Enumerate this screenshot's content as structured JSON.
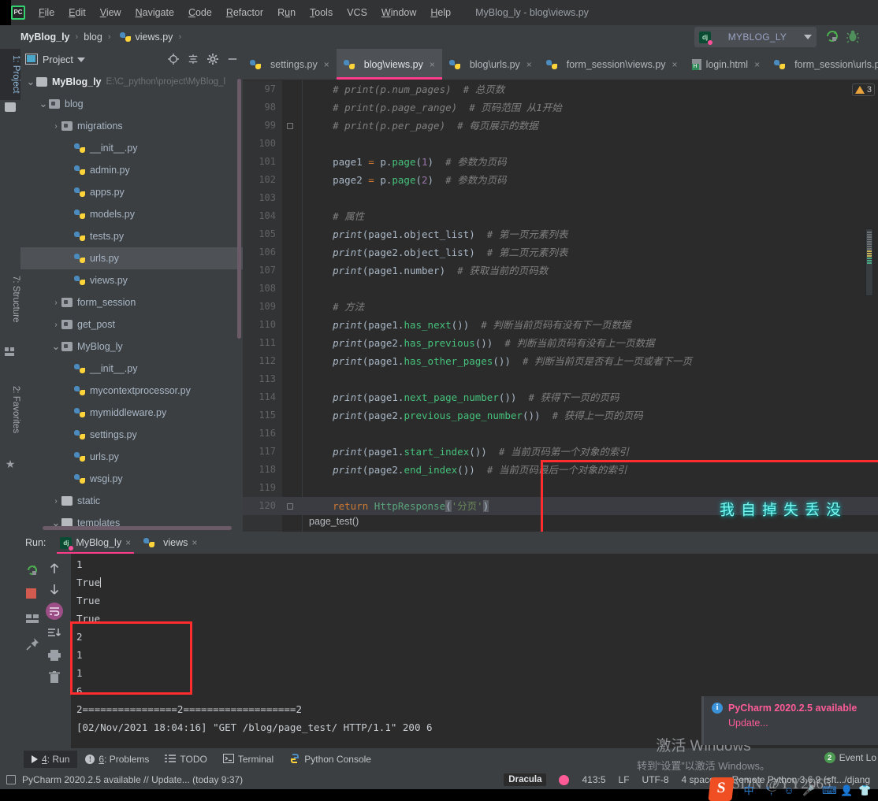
{
  "app": {
    "logo": "PC",
    "window_title": "MyBlog_ly - blog\\views.py"
  },
  "menu": {
    "items": [
      "File",
      "Edit",
      "View",
      "Navigate",
      "Code",
      "Refactor",
      "Run",
      "Tools",
      "VCS",
      "Window",
      "Help"
    ]
  },
  "breadcrumb": {
    "items": [
      "MyBlog_ly",
      "blog",
      "views.py"
    ],
    "separator": "›"
  },
  "toolbar": {
    "run_config": "MYBLOG_LY",
    "run_icon": "run-icon",
    "debug_icon": "debug-icon",
    "dj_icon": "dj"
  },
  "left_strip": {
    "project_tab": "1: Project",
    "structure_tab": "7: Structure",
    "favorites_tab": "2: Favorites"
  },
  "project_panel": {
    "title": "Project",
    "icons": [
      "locate-icon",
      "collapse-all-icon",
      "gear-icon",
      "minimize-icon"
    ],
    "tree": [
      {
        "indent": 0,
        "arrow": "⌄",
        "icon": "folder",
        "name": "MyBlog_ly",
        "path": "E:\\C_python\\project\\MyBlog_l",
        "root": true
      },
      {
        "indent": 1,
        "arrow": "⌄",
        "icon": "folder-mod",
        "name": "blog"
      },
      {
        "indent": 2,
        "arrow": "›",
        "icon": "folder-mod",
        "name": "migrations"
      },
      {
        "indent": 3,
        "arrow": "",
        "icon": "py",
        "name": "__init__.py"
      },
      {
        "indent": 3,
        "arrow": "",
        "icon": "py",
        "name": "admin.py"
      },
      {
        "indent": 3,
        "arrow": "",
        "icon": "py",
        "name": "apps.py"
      },
      {
        "indent": 3,
        "arrow": "",
        "icon": "py",
        "name": "models.py"
      },
      {
        "indent": 3,
        "arrow": "",
        "icon": "py",
        "name": "tests.py"
      },
      {
        "indent": 3,
        "arrow": "",
        "icon": "py",
        "name": "urls.py",
        "selected": true
      },
      {
        "indent": 3,
        "arrow": "",
        "icon": "py",
        "name": "views.py"
      },
      {
        "indent": 2,
        "arrow": "›",
        "icon": "folder-mod",
        "name": "form_session"
      },
      {
        "indent": 2,
        "arrow": "›",
        "icon": "folder-mod",
        "name": "get_post"
      },
      {
        "indent": 2,
        "arrow": "⌄",
        "icon": "folder-mod",
        "name": "MyBlog_ly"
      },
      {
        "indent": 3,
        "arrow": "",
        "icon": "py",
        "name": "__init__.py"
      },
      {
        "indent": 3,
        "arrow": "",
        "icon": "py",
        "name": "mycontextprocessor.py"
      },
      {
        "indent": 3,
        "arrow": "",
        "icon": "py",
        "name": "mymiddleware.py"
      },
      {
        "indent": 3,
        "arrow": "",
        "icon": "py",
        "name": "settings.py"
      },
      {
        "indent": 3,
        "arrow": "",
        "icon": "py",
        "name": "urls.py"
      },
      {
        "indent": 3,
        "arrow": "",
        "icon": "py",
        "name": "wsgi.py"
      },
      {
        "indent": 2,
        "arrow": "›",
        "icon": "folder",
        "name": "static"
      },
      {
        "indent": 2,
        "arrow": "⌄",
        "icon": "folder",
        "name": "templates"
      }
    ]
  },
  "editor": {
    "tabs": [
      {
        "label": "settings.py",
        "icon": "py",
        "active": false
      },
      {
        "label": "blog\\views.py",
        "icon": "py",
        "active": true
      },
      {
        "label": "blog\\urls.py",
        "icon": "py",
        "active": false
      },
      {
        "label": "form_session\\views.py",
        "icon": "py",
        "active": false
      },
      {
        "label": "login.html",
        "icon": "html",
        "active": false
      },
      {
        "label": "form_session\\urls.py",
        "icon": "py",
        "active": false
      }
    ],
    "close_glyph": "×",
    "warning_count": "3",
    "bottom_breadcrumb": "page_test()",
    "lines": [
      {
        "num": "97",
        "html": "    <span class='cm'># print(p.num_pages)  # 总页数</span>"
      },
      {
        "num": "98",
        "html": "    <span class='cm'># print(p.page_range)  # 页码范围 从1开始</span>"
      },
      {
        "num": "99",
        "html": "    <span class='cm'># print(p.per_page)  # 每页展示的数据</span>",
        "fold": true
      },
      {
        "num": "100",
        "html": ""
      },
      {
        "num": "101",
        "html": "    page1 <span class='kw'>=</span> p.<span class='mt'>page</span>(<span class='num2'>1</span>)  <span class='cm'># 参数为页码</span>"
      },
      {
        "num": "102",
        "html": "    page2 <span class='kw'>=</span> p.<span class='mt'>page</span>(<span class='num2'>2</span>)  <span class='cm'># 参数为页码</span>"
      },
      {
        "num": "103",
        "html": ""
      },
      {
        "num": "104",
        "html": "    <span class='cm'># 属性</span>"
      },
      {
        "num": "105",
        "html": "    <span class='fn'>print</span>(page1.object_list)  <span class='cm'># 第一页元素列表</span>"
      },
      {
        "num": "106",
        "html": "    <span class='fn'>print</span>(page2.object_list)  <span class='cm'># 第二页元素列表</span>"
      },
      {
        "num": "107",
        "html": "    <span class='fn'>print</span>(page1.number)  <span class='cm'># 获取当前的页码数</span>"
      },
      {
        "num": "108",
        "html": ""
      },
      {
        "num": "109",
        "html": "    <span class='cm'># 方法</span>"
      },
      {
        "num": "110",
        "html": "    <span class='fn'>print</span>(page1.<span class='mt'>has_next</span>())  <span class='cm'># 判断当前页码有没有下一页数据</span>"
      },
      {
        "num": "111",
        "html": "    <span class='fn'>print</span>(page2.<span class='mt'>has_previous</span>())  <span class='cm'># 判断当前页码有没有上一页数据</span>"
      },
      {
        "num": "112",
        "html": "    <span class='fn'>print</span>(page1.<span class='mt'>has_other_pages</span>())  <span class='cm'># 判断当前页是否有上一页或者下一页</span>"
      },
      {
        "num": "113",
        "html": ""
      },
      {
        "num": "114",
        "html": "    <span class='fn'>print</span>(page1.<span class='mt'>next_page_number</span>())  <span class='cm'># 获得下一页的页码</span>"
      },
      {
        "num": "115",
        "html": "    <span class='fn'>print</span>(page2.<span class='mt'>previous_page_number</span>())  <span class='cm'># 获得上一页的页码</span>"
      },
      {
        "num": "116",
        "html": ""
      },
      {
        "num": "117",
        "html": "    <span class='fn'>print</span>(page1.<span class='mt'>start_index</span>())  <span class='cm'># 当前页码第一个对象的索引</span>"
      },
      {
        "num": "118",
        "html": "    <span class='fn'>print</span>(page2.<span class='mt'>end_index</span>())  <span class='cm'># 当前页码最后一个对象的索引</span>"
      },
      {
        "num": "119",
        "html": ""
      },
      {
        "num": "120",
        "html": "    <span class='kw'>return</span> <span class='cls'>HttpResponse</span><span class='sel-str'>(</span><span class='str'>'分页'</span><span class='sel-str'>)</span>",
        "current": true,
        "fold": true
      }
    ]
  },
  "overlay": {
    "vertical_text": "没丢失掉自我"
  },
  "run_panel": {
    "label": "Run:",
    "tabs": [
      {
        "label": "MyBlog_ly",
        "icon": "dj-icon",
        "active": true
      },
      {
        "label": "views",
        "icon": "py-icon",
        "active": false
      }
    ],
    "close_glyph": "×",
    "toolbar_icons": [
      "rerun-icon",
      "stop-icon",
      "layout-icon",
      "pin-icon",
      "up-icon",
      "down-icon",
      "soft-wrap-icon",
      "scroll-to-end-icon",
      "print-icon",
      "trash-icon"
    ],
    "console_lines": [
      "1",
      "True",
      "True",
      "True",
      "2",
      "1",
      "1",
      "6",
      "2================2===================2",
      "[02/Nov/2021 18:04:16] \"GET /blog/page_test/ HTTP/1.1\" 200 6"
    ]
  },
  "notification": {
    "title": "PyCharm 2020.2.5 available",
    "action": "Update..."
  },
  "windows_watermark": {
    "line1": "激活 Windows",
    "line2": "转到“设置”以激活 Windows。"
  },
  "bottom_bar": {
    "items": [
      {
        "label": "4: Run",
        "icon": "play-icon",
        "active": true
      },
      {
        "label": "6: Problems",
        "icon": "problems-icon",
        "active": false
      },
      {
        "label": "TODO",
        "icon": "todo-icon",
        "active": false
      },
      {
        "label": "Terminal",
        "icon": "terminal-icon",
        "active": false
      },
      {
        "label": "Python Console",
        "icon": "python-console-icon",
        "active": false
      }
    ]
  },
  "status_bar": {
    "message": "PyCharm 2020.2.5 available // Update... (today 9:37)",
    "theme": "Dracula",
    "caret": "413:5",
    "line_sep": "LF",
    "encoding": "UTF-8",
    "indent": "4 spaces",
    "interpreter": "Remote Python 3.6.9 (sft.../djang",
    "event_log": "Event Lo",
    "event_count": "2"
  },
  "watermark": {
    "csdn": "CSDN @YY2065"
  },
  "colors": {
    "accent_pink": "#ff3c8c",
    "redbox": "#ff2d2d",
    "editor_bg": "#2b2b2b",
    "panel_bg": "#3c3f41",
    "cyan_text": "#7cf7f0"
  }
}
